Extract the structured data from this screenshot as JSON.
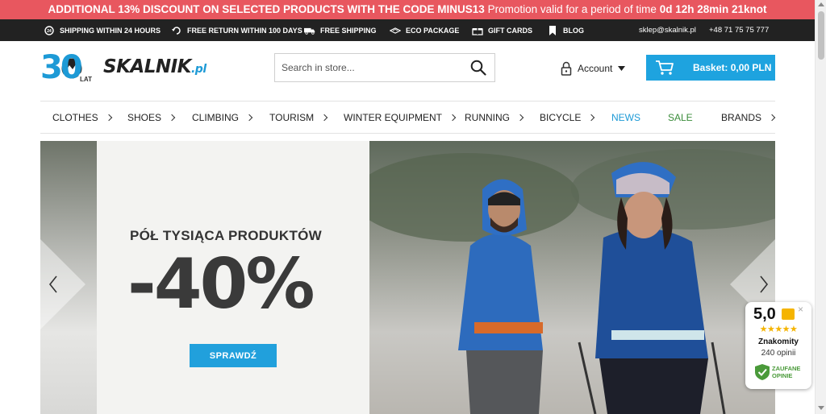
{
  "promo": {
    "highlight": "ADDITIONAL 13% DISCOUNT ON SELECTED PRODUCTS WITH THE CODE MINUS13",
    "text": "Promotion valid for a period of time",
    "countdown": "0d 12h 28min 21knot",
    "background": "#e8575f"
  },
  "infobar": {
    "items": [
      {
        "label": "SHIPPING WITHIN 24 HOURS",
        "icon": "clock-24-icon"
      },
      {
        "label": "FREE RETURN WITHIN 100 DAYS",
        "icon": "return-icon"
      },
      {
        "label": "FREE SHIPPING",
        "icon": "truck-icon"
      },
      {
        "label": "ECO PACKAGE",
        "icon": "eco-package-icon"
      },
      {
        "label": "GIFT CARDS",
        "icon": "gift-icon"
      },
      {
        "label": "BLOG",
        "icon": "bookmark-icon"
      }
    ],
    "email": "sklep@skalnik.pl",
    "phone": "+48 71 75 75 777"
  },
  "header": {
    "logo": {
      "number": "30",
      "sub": "LAT",
      "brand": "SKALNIK",
      "tld": ".pl"
    },
    "search": {
      "placeholder": "Search in store..."
    },
    "account": {
      "label": "Account"
    },
    "basket": {
      "label": "Basket: 0,00 PLN",
      "color": "#1ea3df"
    }
  },
  "nav": {
    "items": [
      {
        "label": "CLOTHES",
        "chevron": true
      },
      {
        "label": "SHOES",
        "chevron": true
      },
      {
        "label": "CLIMBING",
        "chevron": true
      },
      {
        "label": "TOURISM",
        "chevron": true
      },
      {
        "label": "WINTER EQUIPMENT",
        "chevron": true
      },
      {
        "label": "RUNNING",
        "chevron": true
      },
      {
        "label": "BICYCLE",
        "chevron": true
      },
      {
        "label": "NEWS",
        "chevron": false,
        "color": "#1d9ad6"
      },
      {
        "label": "SALE",
        "chevron": false,
        "color": "#3a8c3a"
      },
      {
        "label": "BRANDS",
        "chevron": true
      }
    ]
  },
  "banner": {
    "headline": "PÓŁ TYSIĄCA PRODUKTÓW",
    "discount": "-40%",
    "cta": "SPRAWDŹ"
  },
  "rating": {
    "score": "5,0",
    "stars": "★★★★★",
    "label": "Znakomity",
    "count": "240 opinii",
    "badge_line1": "ZAUFANE",
    "badge_line2": "OPINIE",
    "close": "×"
  }
}
